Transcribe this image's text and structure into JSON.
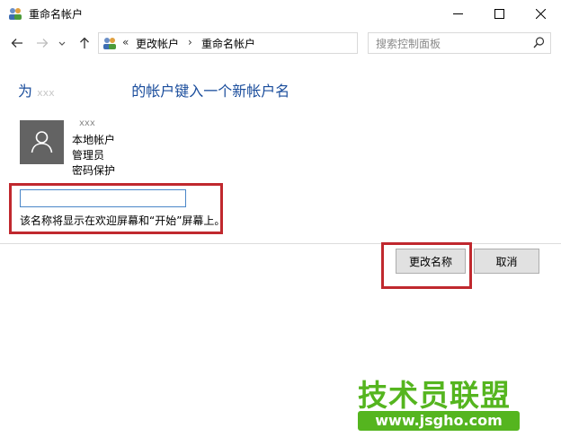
{
  "window": {
    "title": "重命名帐户",
    "minimize_icon": "minimize-icon",
    "maximize_icon": "maximize-icon",
    "close_icon": "close-icon"
  },
  "nav": {
    "breadcrumb_overflow": "«",
    "crumbs": [
      "更改帐户",
      "重命名帐户"
    ],
    "separator": "›",
    "search_placeholder": "搜索控制面板"
  },
  "main": {
    "heading_prefix": "为",
    "heading_username": "xxx",
    "heading_suffix": "的帐户键入一个新帐户名",
    "account": {
      "name": "xxx",
      "type": "本地帐户",
      "role": "管理员",
      "protection": "密码保护"
    },
    "input_value": "",
    "hint": "该名称将显示在欢迎屏幕和“开始”屏幕上。"
  },
  "buttons": {
    "rename": "更改名称",
    "cancel": "取消"
  },
  "watermark": {
    "title": "技术员联盟",
    "url": "www.jsgho.com"
  },
  "colors": {
    "heading": "#1a4d9c",
    "highlight": "#c0282e",
    "watermark": "#55b51f"
  }
}
